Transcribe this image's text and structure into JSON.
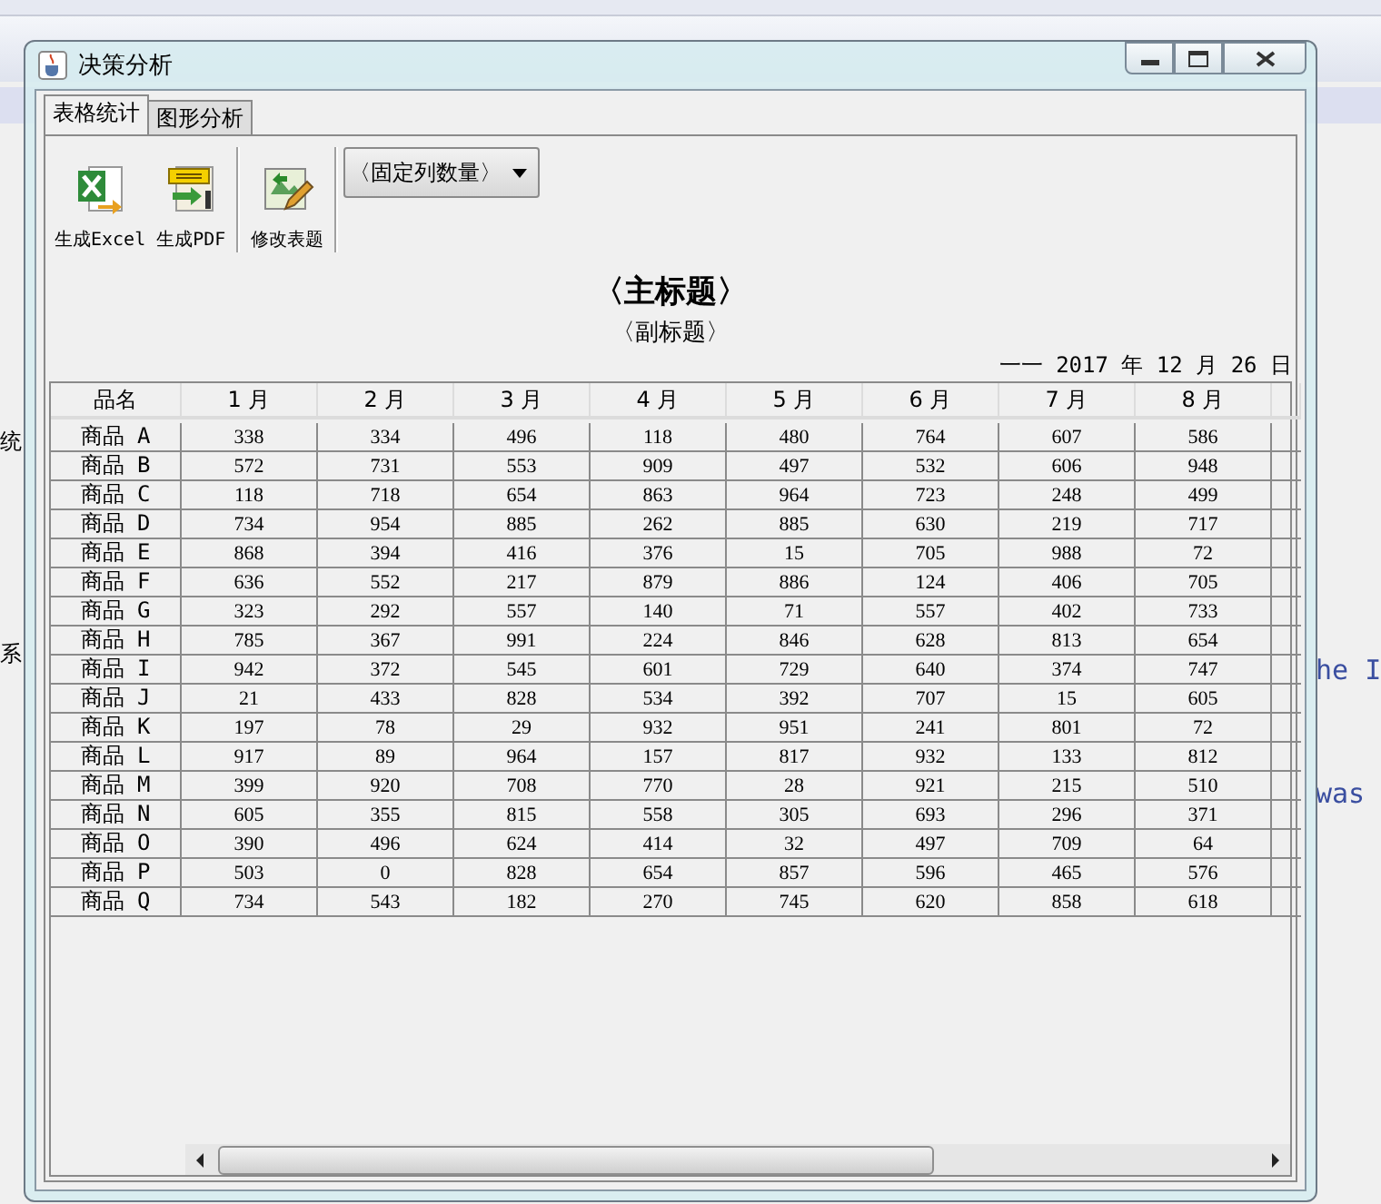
{
  "background": {
    "side_texts": [
      "统",
      "系"
    ],
    "editor_texts": [
      "he I",
      "was"
    ]
  },
  "window": {
    "title": "决策分析"
  },
  "tabs": [
    {
      "label": "表格统计",
      "selected": true
    },
    {
      "label": "图形分析",
      "selected": false
    }
  ],
  "toolbar": {
    "buttons": [
      {
        "kind": "excel",
        "label": "生成Excel"
      },
      {
        "kind": "pdf",
        "label": "生成PDF"
      },
      {
        "kind": "edit",
        "label": "修改表题"
      }
    ],
    "dropdown": {
      "value": "〈固定列数量〉"
    }
  },
  "report": {
    "title": "〈主标题〉",
    "subtitle": "〈副标题〉",
    "date": "一一 2017 年 12 月 26 日"
  },
  "table": {
    "columns": [
      "品名",
      "1 月",
      "2 月",
      "3 月",
      "4 月",
      "5 月",
      "6 月",
      "7 月",
      "8 月"
    ],
    "rows": [
      [
        "商品 A",
        "338",
        "334",
        "496",
        "118",
        "480",
        "764",
        "607",
        "586"
      ],
      [
        "商品 B",
        "572",
        "731",
        "553",
        "909",
        "497",
        "532",
        "606",
        "948"
      ],
      [
        "商品 C",
        "118",
        "718",
        "654",
        "863",
        "964",
        "723",
        "248",
        "499"
      ],
      [
        "商品 D",
        "734",
        "954",
        "885",
        "262",
        "885",
        "630",
        "219",
        "717"
      ],
      [
        "商品 E",
        "868",
        "394",
        "416",
        "376",
        "15",
        "705",
        "988",
        "72"
      ],
      [
        "商品 F",
        "636",
        "552",
        "217",
        "879",
        "886",
        "124",
        "406",
        "705"
      ],
      [
        "商品 G",
        "323",
        "292",
        "557",
        "140",
        "71",
        "557",
        "402",
        "733"
      ],
      [
        "商品 H",
        "785",
        "367",
        "991",
        "224",
        "846",
        "628",
        "813",
        "654"
      ],
      [
        "商品 I",
        "942",
        "372",
        "545",
        "601",
        "729",
        "640",
        "374",
        "747"
      ],
      [
        "商品 J",
        "21",
        "433",
        "828",
        "534",
        "392",
        "707",
        "15",
        "605"
      ],
      [
        "商品 K",
        "197",
        "78",
        "29",
        "932",
        "951",
        "241",
        "801",
        "72"
      ],
      [
        "商品 L",
        "917",
        "89",
        "964",
        "157",
        "817",
        "932",
        "133",
        "812"
      ],
      [
        "商品 M",
        "399",
        "920",
        "708",
        "770",
        "28",
        "921",
        "215",
        "510"
      ],
      [
        "商品 N",
        "605",
        "355",
        "815",
        "558",
        "305",
        "693",
        "296",
        "371"
      ],
      [
        "商品 O",
        "390",
        "496",
        "624",
        "414",
        "32",
        "497",
        "709",
        "64"
      ],
      [
        "商品 P",
        "503",
        "0",
        "828",
        "654",
        "857",
        "596",
        "465",
        "576"
      ],
      [
        "商品 Q",
        "734",
        "543",
        "182",
        "270",
        "745",
        "620",
        "858",
        "618"
      ]
    ]
  }
}
